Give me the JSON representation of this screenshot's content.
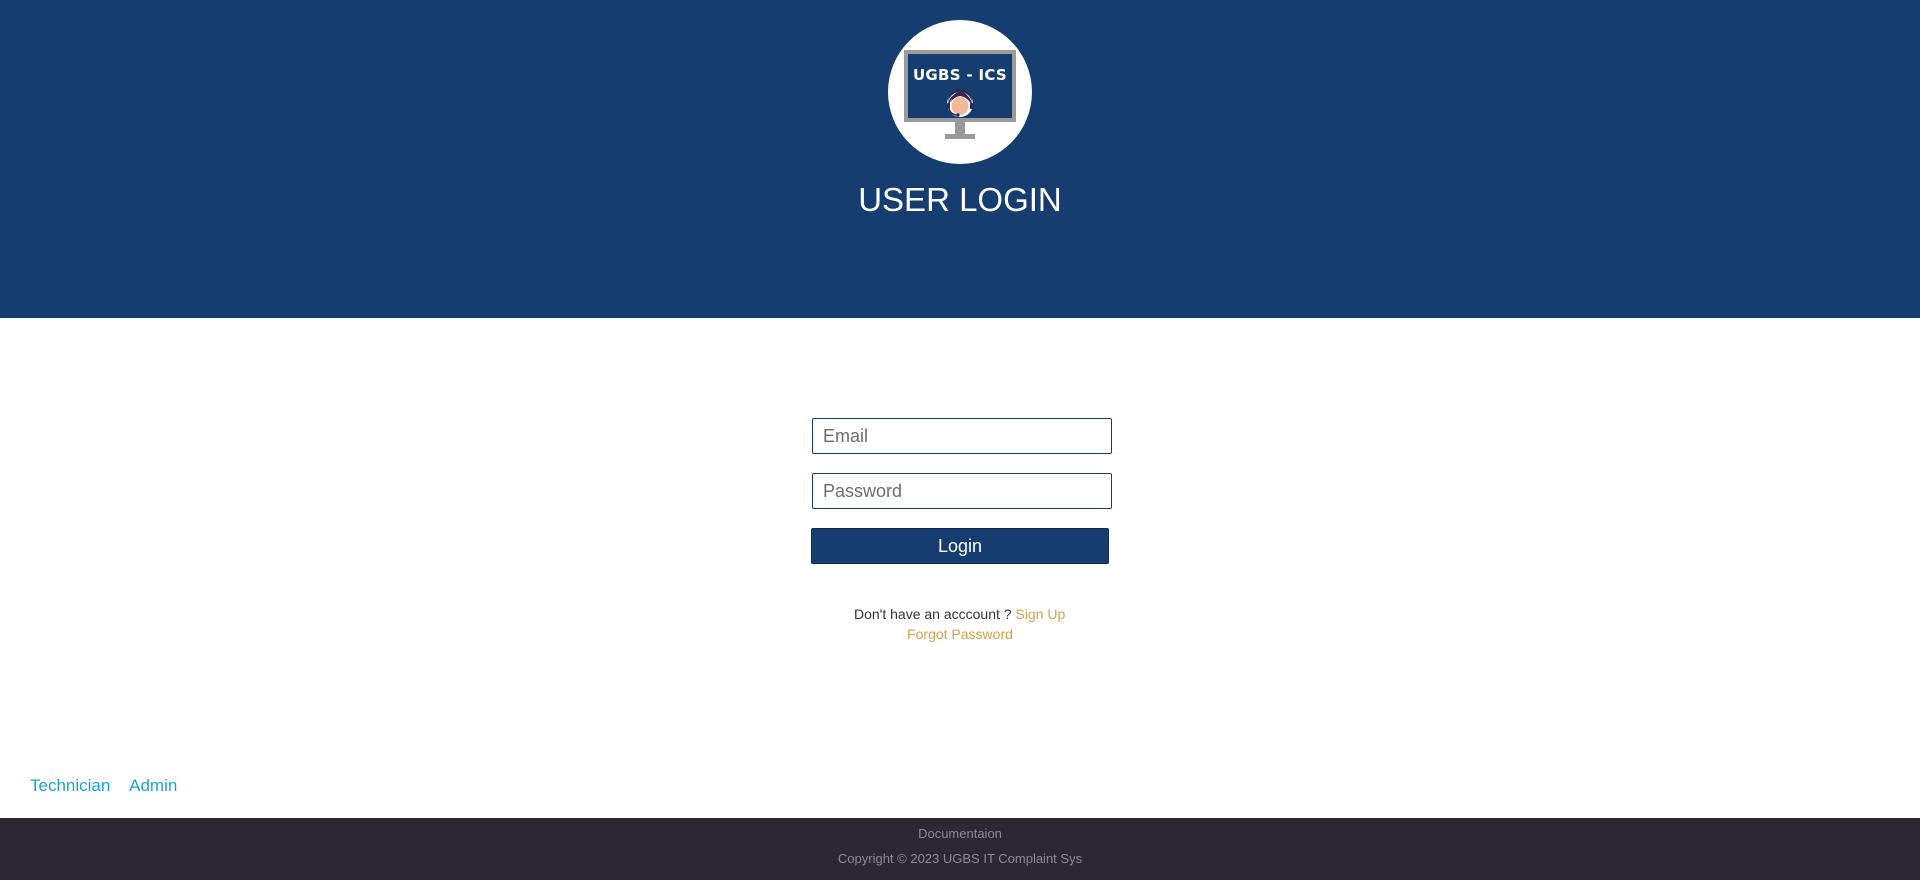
{
  "header": {
    "logo_text": "UGBS - ICS",
    "logo_icon": "support-agent-monitor-icon",
    "title": "USER LOGIN",
    "background_color": "#153d70"
  },
  "form": {
    "email_placeholder": "Email",
    "email_value": "",
    "password_placeholder": "Password",
    "password_value": "",
    "login_label": "Login"
  },
  "links": {
    "signup_prompt": "Don't have an acccount ?",
    "signup_label": "Sign Up",
    "forgot_label": "Forgot Password",
    "accent_color": "#d5a24a"
  },
  "roles": [
    {
      "label": "Technician"
    },
    {
      "label": "Admin"
    }
  ],
  "footer": {
    "doc_link": "Documentaion",
    "copyright": "Copyright © 2023 UGBS IT Complaint Sys",
    "background_color": "#2b2733"
  }
}
